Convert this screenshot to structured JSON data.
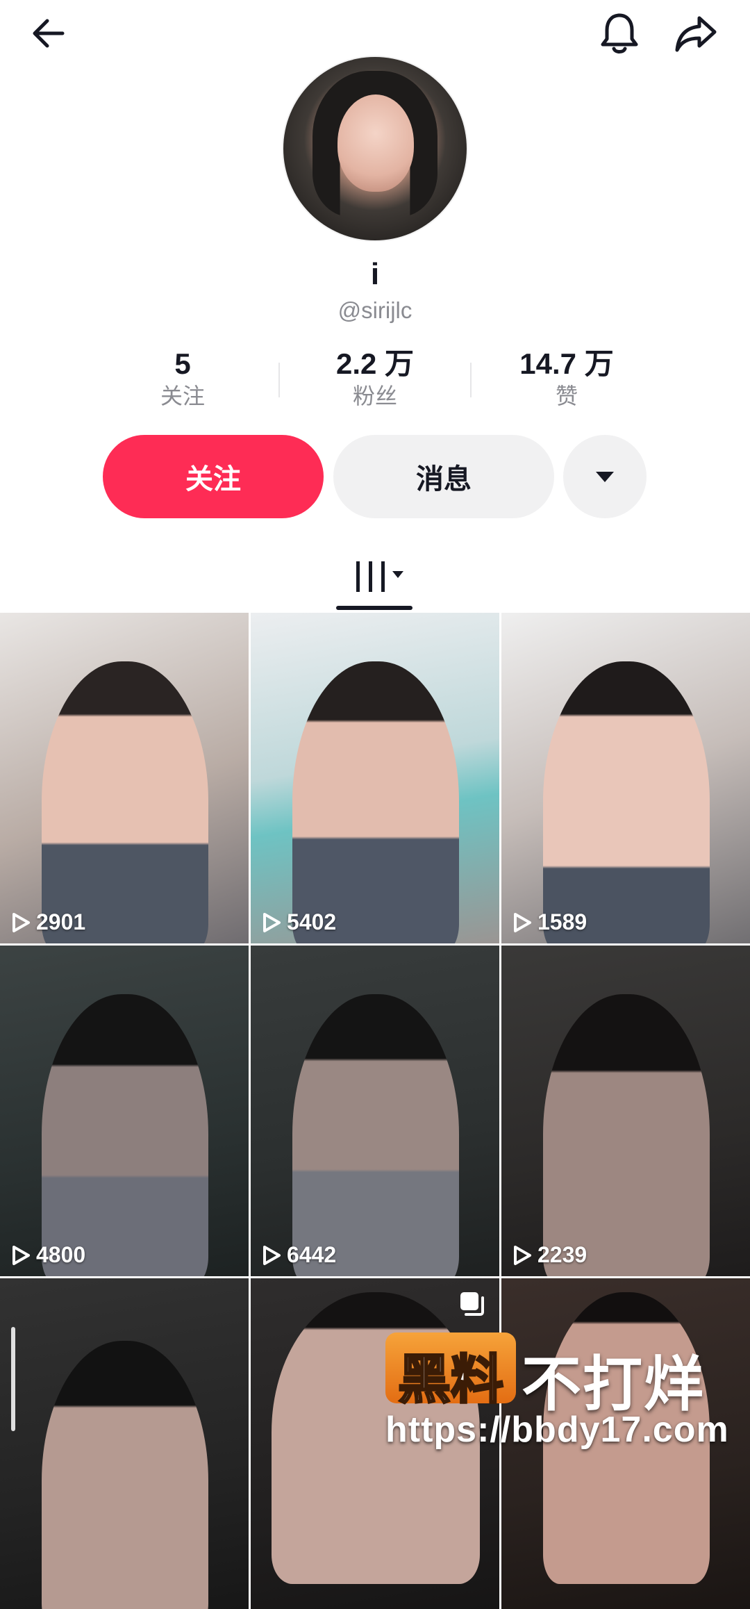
{
  "header": {
    "back_icon": "arrow-left-icon",
    "notification_icon": "bell-icon",
    "share_icon": "share-arrow-icon"
  },
  "profile": {
    "display_name": "i",
    "handle": "@sirijlc"
  },
  "stats": [
    {
      "value": "5",
      "label": "关注"
    },
    {
      "value": "2.2 万",
      "label": "粉丝"
    },
    {
      "value": "14.7 万",
      "label": "赞"
    }
  ],
  "actions": {
    "follow_label": "关注",
    "message_label": "消息",
    "more_icon": "caret-down-icon"
  },
  "tabs": {
    "active_icon": "video-grid-icon"
  },
  "videos": [
    {
      "plays": "2901"
    },
    {
      "plays": "5402"
    },
    {
      "plays": "1589"
    },
    {
      "plays": "4800"
    },
    {
      "plays": "6442"
    },
    {
      "plays": "2239"
    },
    {
      "plays": ""
    },
    {
      "plays": ""
    },
    {
      "plays": ""
    }
  ],
  "watermark": {
    "badge": "黑料",
    "text": "不打烊",
    "url": "https://bbdy17.com"
  },
  "colors": {
    "accent": "#fe2c55",
    "secondary_button": "#f1f1f2",
    "muted_text": "#8a8b91"
  }
}
